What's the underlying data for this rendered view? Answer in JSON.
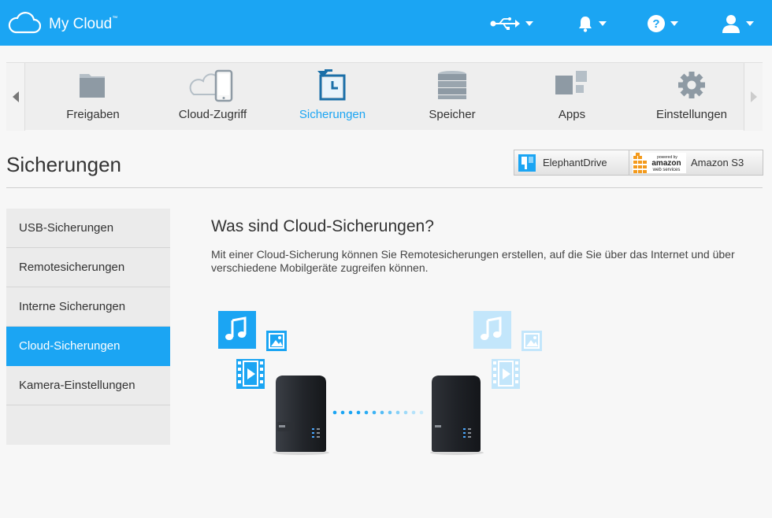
{
  "app": {
    "title": "My Cloud",
    "tm": "™"
  },
  "header": {
    "icons": [
      "usb-icon",
      "bell-icon",
      "help-icon",
      "user-icon"
    ]
  },
  "nav": {
    "items": [
      {
        "label": "Freigaben",
        "icon": "folder-icon"
      },
      {
        "label": "Cloud-Zugriff",
        "icon": "cloud-phone-icon"
      },
      {
        "label": "Sicherungen",
        "icon": "backup-clock-icon",
        "active": true
      },
      {
        "label": "Speicher",
        "icon": "database-icon"
      },
      {
        "label": "Apps",
        "icon": "apps-icon"
      },
      {
        "label": "Einstellungen",
        "icon": "gear-icon"
      }
    ]
  },
  "page": {
    "title": "Sicherungen",
    "providers": [
      {
        "label": "ElephantDrive",
        "icon": "elephantdrive-logo"
      },
      {
        "label": "Amazon S3",
        "logo_text": [
          "powered by",
          "amazon",
          "web services"
        ]
      }
    ]
  },
  "sidebar": {
    "items": [
      {
        "label": "USB-Sicherungen"
      },
      {
        "label": "Remotesicherungen"
      },
      {
        "label": "Interne Sicherungen"
      },
      {
        "label": "Cloud-Sicherungen",
        "active": true
      },
      {
        "label": "Kamera-Einstellungen"
      }
    ]
  },
  "content": {
    "heading": "Was sind Cloud-Sicherungen?",
    "description": "Mit einer Cloud-Sicherung können Sie Remotesicherungen erstellen, auf die Sie über das Internet und über verschiedene Mobilgeräte zugreifen können."
  },
  "colors": {
    "accent": "#1ba5f3",
    "accent_light": "#c3e6fb",
    "nav_bg": "#eeeeee",
    "sidebar_bg": "#ebebeb"
  }
}
